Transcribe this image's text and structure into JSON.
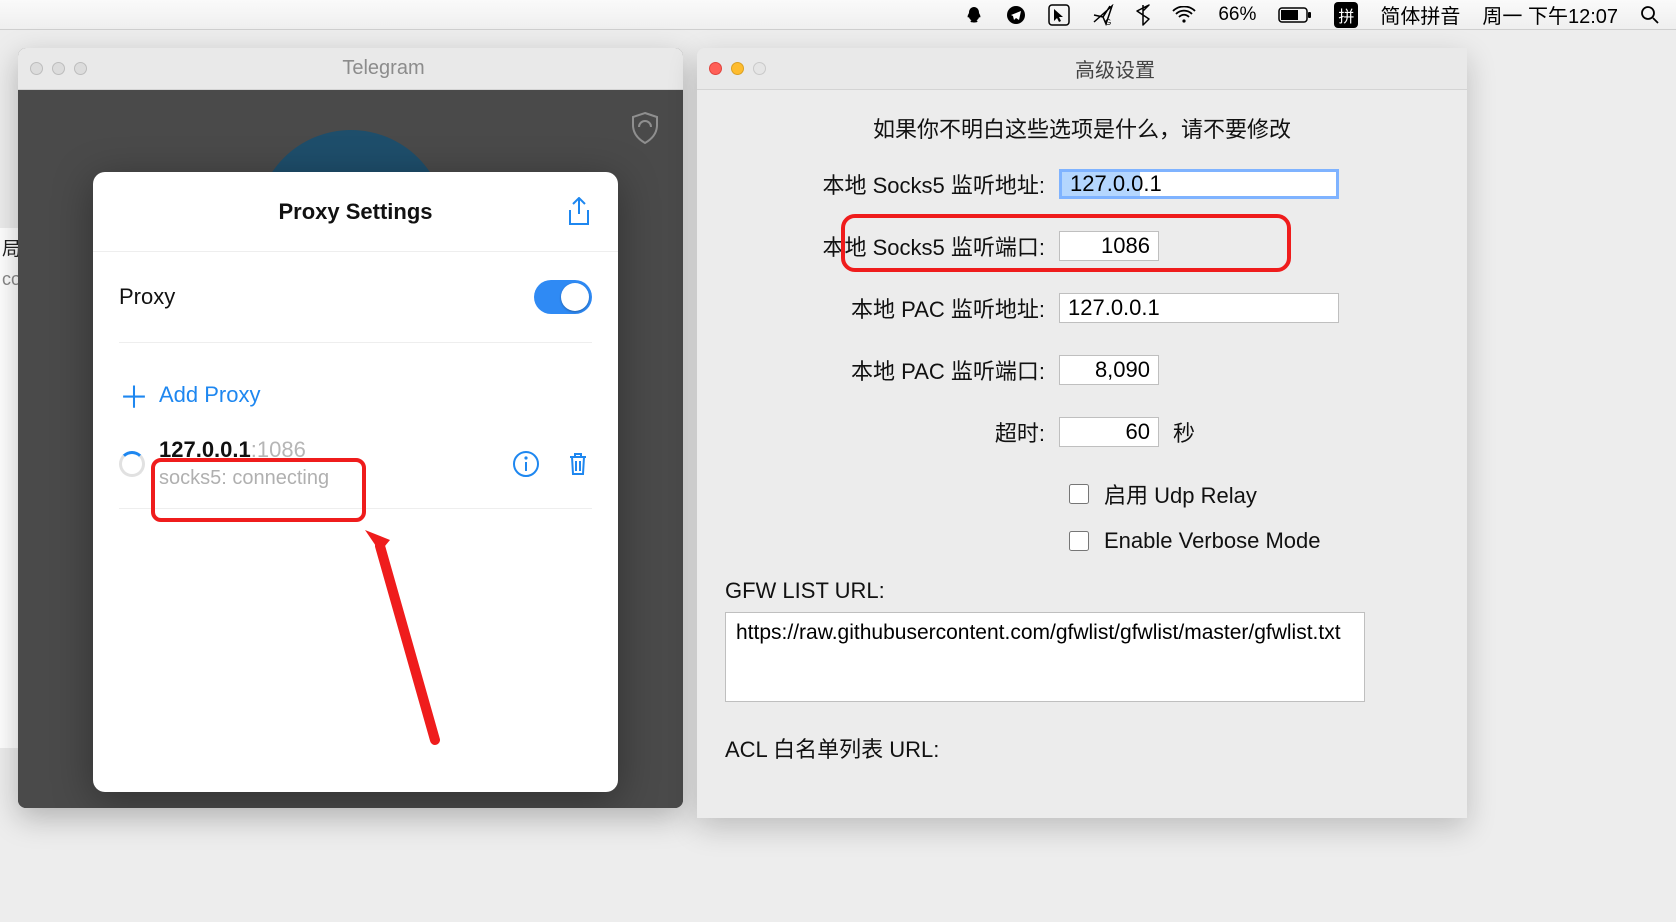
{
  "menubar": {
    "battery_percent": "66%",
    "ime_badge": "拼",
    "ime_label": "简体拼音",
    "clock": "周一 下午12:07"
  },
  "telegram": {
    "window_title": "Telegram",
    "chat_hint_line1": "局",
    "chat_hint_line2": "co",
    "sheet_title": "Proxy Settings",
    "proxy_label": "Proxy",
    "add_proxy_label": "Add Proxy",
    "entry_ip": "127.0.0.1",
    "entry_port": ":1086",
    "entry_status": "socks5: connecting"
  },
  "advanced": {
    "window_title": "高级设置",
    "warning": "如果你不明白这些选项是什么，请不要修改",
    "socks5_addr_label": "本地 Socks5 监听地址:",
    "socks5_addr_value": "127.0.0.1",
    "socks5_port_label": "本地 Socks5 监听端口:",
    "socks5_port_value": "1086",
    "pac_addr_label": "本地 PAC 监听地址:",
    "pac_addr_value": "127.0.0.1",
    "pac_port_label": "本地 PAC 监听端口:",
    "pac_port_value": "8,090",
    "timeout_label": "超时:",
    "timeout_value": "60",
    "timeout_suffix": "秒",
    "udp_relay_label": "启用 Udp Relay",
    "verbose_label": "Enable Verbose Mode",
    "gfw_label": "GFW LIST URL:",
    "gfw_value": "https://raw.githubusercontent.com/gfwlist/gfwlist/master/gfwlist.txt",
    "acl_label": "ACL 白名单列表 URL:"
  }
}
